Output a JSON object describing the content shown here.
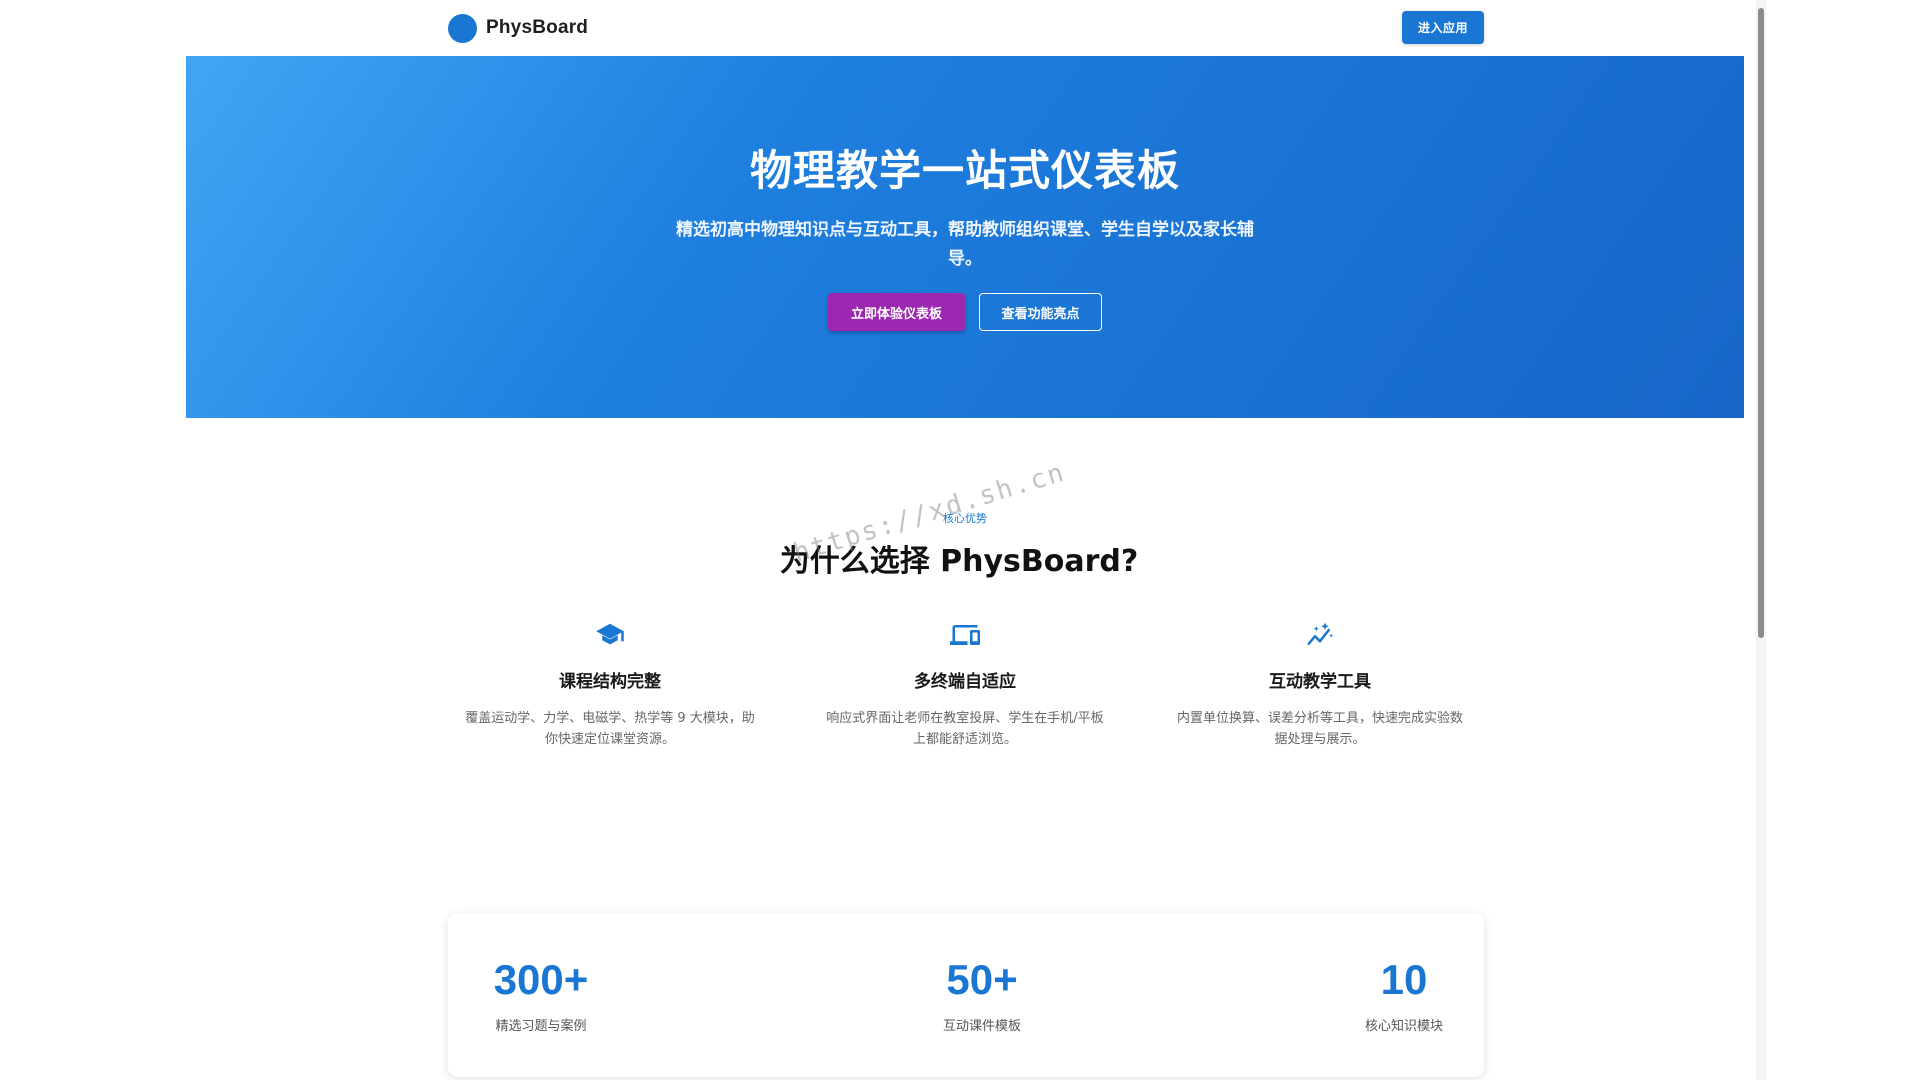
{
  "header": {
    "brand_name": "PhysBoard",
    "enter_button": "进入应用"
  },
  "hero": {
    "title": "物理教学一站式仪表板",
    "subtitle": "精选初高中物理知识点与互动工具，帮助教师组织课堂、学生自学以及家长辅导。",
    "primary_button": "立即体验仪表板",
    "secondary_button": "查看功能亮点"
  },
  "features": {
    "eyebrow": "核心优势",
    "title": "为什么选择 PhysBoard?",
    "items": [
      {
        "icon": "graduation-cap-icon",
        "title": "课程结构完整",
        "desc": "覆盖运动学、力学、电磁学、热学等 9 大模块，助你快速定位课堂资源。"
      },
      {
        "icon": "devices-icon",
        "title": "多终端自适应",
        "desc": "响应式界面让老师在教室投屏、学生在手机/平板上都能舒适浏览。"
      },
      {
        "icon": "sparkle-chart-icon",
        "title": "互动教学工具",
        "desc": "内置单位换算、误差分析等工具，快速完成实验数据处理与展示。"
      }
    ]
  },
  "stats": [
    {
      "value": "300+",
      "label": "精选习题与案例"
    },
    {
      "value": "50+",
      "label": "互动课件模板"
    },
    {
      "value": "10",
      "label": "核心知识模块"
    }
  ],
  "watermark": "https://xd.sh.cn",
  "colors": {
    "primary": "#1976d2",
    "accent": "#9c27b0"
  }
}
